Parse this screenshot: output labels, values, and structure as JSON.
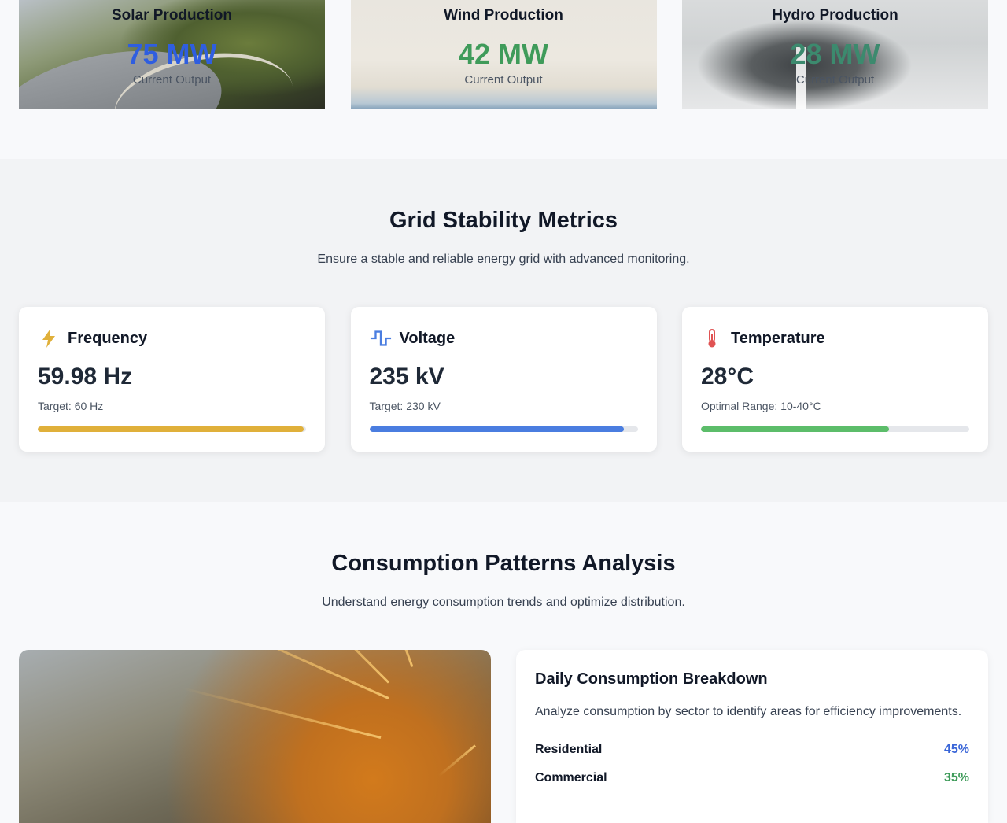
{
  "production": [
    {
      "title": "Solar Production",
      "value": "75 MW",
      "sub": "Current Output",
      "color": "#2f5ee0"
    },
    {
      "title": "Wind Production",
      "value": "42 MW",
      "sub": "Current Output",
      "color": "#3f9b5a"
    },
    {
      "title": "Hydro Production",
      "value": "28 MW",
      "sub": "Current Output",
      "color": "#3c8a6e"
    }
  ],
  "grid": {
    "title": "Grid Stability Metrics",
    "subtitle": "Ensure a stable and reliable energy grid with advanced monitoring.",
    "metrics": [
      {
        "label": "Frequency",
        "icon": "lightning-icon",
        "value": "59.98 Hz",
        "note": "Target: 60 Hz",
        "level": 0.99,
        "color": "#e0b03a"
      },
      {
        "label": "Voltage",
        "icon": "pulse-icon",
        "value": "235 kV",
        "note": "Target: 230 kV",
        "level": 0.95,
        "color": "#4a7de0"
      },
      {
        "label": "Temperature",
        "icon": "thermometer-icon",
        "value": "28°C",
        "note": "Optimal Range: 10-40°C",
        "level": 0.7,
        "color": "#5cbd6a"
      }
    ]
  },
  "consumption": {
    "title": "Consumption Patterns Analysis",
    "subtitle": "Understand energy consumption trends and optimize distribution.",
    "card": {
      "title": "Daily Consumption Breakdown",
      "desc": "Analyze consumption by sector to identify areas for efficiency improvements.",
      "sectors": [
        {
          "name": "Residential",
          "value": "45%",
          "color": "#3a66d8"
        },
        {
          "name": "Commercial",
          "value": "35%",
          "color": "#3f9b5a"
        }
      ]
    }
  }
}
